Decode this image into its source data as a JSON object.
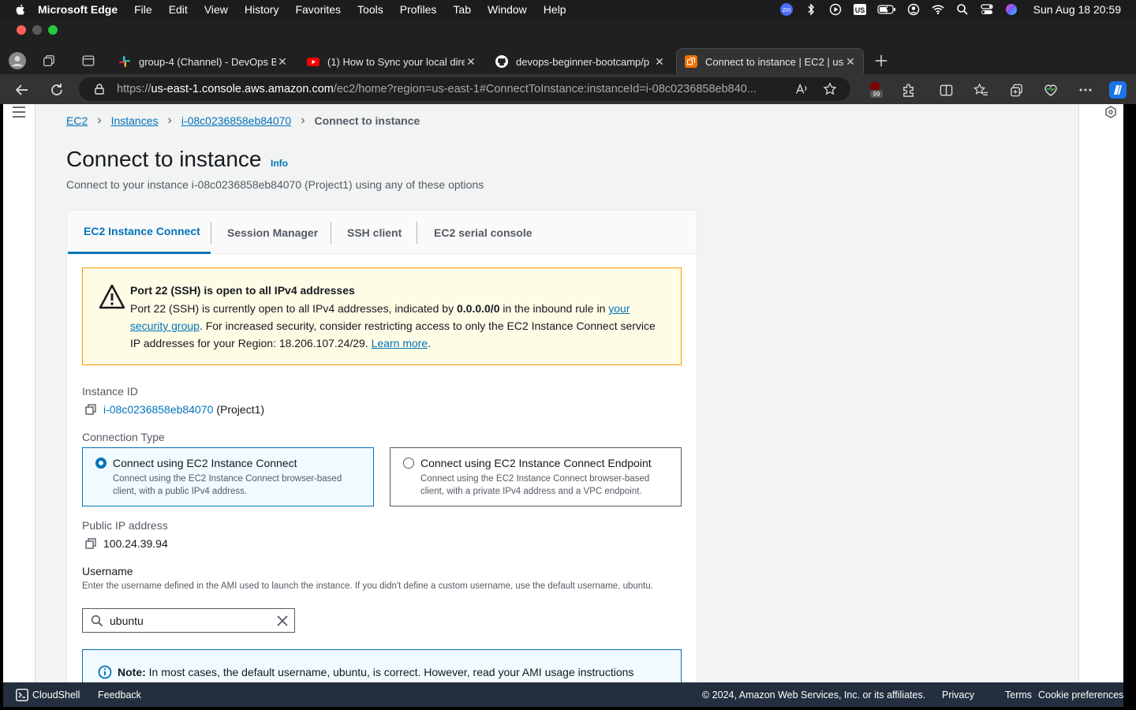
{
  "menubar": {
    "app": "Microsoft Edge",
    "items": [
      "File",
      "Edit",
      "View",
      "History",
      "Favorites",
      "Tools",
      "Profiles",
      "Tab",
      "Window",
      "Help"
    ],
    "clock": "Sun Aug 18  20:59",
    "status_icons": [
      "zoom-icon",
      "bluetooth-icon",
      "play-icon",
      "us-input-icon",
      "battery-icon",
      "user-icon",
      "wifi-icon",
      "spotlight-icon",
      "control-center-icon",
      "siri-icon"
    ],
    "us_label": "US",
    "zoom_label": "zm"
  },
  "tabs": [
    {
      "label": "group-4 (Channel) - DevOps B",
      "icon": "slack-icon"
    },
    {
      "label": "(1) How to Sync your local dire",
      "icon": "youtube-icon"
    },
    {
      "label": "devops-beginner-bootcamp/p",
      "icon": "github-icon"
    },
    {
      "label": "Connect to instance | EC2 | us-",
      "icon": "aws-icon",
      "active": true
    }
  ],
  "urlbar": {
    "scheme": "https://",
    "host": "us-east-1.console.aws.amazon.com",
    "path": "/ec2/home?region=us-east-1#ConnectToInstance:instanceId=i-08c0236858eb840..."
  },
  "extension_badge": "99",
  "breadcrumb": {
    "items": [
      "EC2",
      "Instances",
      "i-08c0236858eb84070"
    ],
    "current": "Connect to instance"
  },
  "page": {
    "title": "Connect to instance",
    "info": "Info",
    "subtitle": "Connect to your instance i-08c0236858eb84070 (Project1) using any of these options"
  },
  "connect_tabs": [
    "EC2 Instance Connect",
    "Session Manager",
    "SSH client",
    "EC2 serial console"
  ],
  "warning": {
    "heading": "Port 22 (SSH) is open to all IPv4 addresses",
    "text1": "Port 22 (SSH) is currently open to all IPv4 addresses, indicated by ",
    "cidr": "0.0.0.0/0",
    "text2": " in the inbound rule in ",
    "link1": "your security group",
    "text3": ". For increased security, consider restricting access to only the EC2 Instance Connect service IP addresses for your Region: 18.206.107.24/29. ",
    "link2": "Learn more",
    "text4": "."
  },
  "instance": {
    "label": "Instance ID",
    "id": "i-08c0236858eb84070",
    "name": "(Project1)"
  },
  "connection_type": {
    "label": "Connection Type",
    "options": [
      {
        "title": "Connect using EC2 Instance Connect",
        "desc": "Connect using the EC2 Instance Connect browser-based client, with a public IPv4 address.",
        "selected": true
      },
      {
        "title": "Connect using EC2 Instance Connect Endpoint",
        "desc": "Connect using the EC2 Instance Connect browser-based client, with a private IPv4 address and a VPC endpoint.",
        "selected": false
      }
    ]
  },
  "public_ip": {
    "label": "Public IP address",
    "value": "100.24.39.94"
  },
  "username": {
    "label": "Username",
    "desc": "Enter the username defined in the AMI used to launch the instance. If you didn't define a custom username, use the default username, ubuntu.",
    "value": "ubuntu"
  },
  "note": {
    "bold": "Note:",
    "text": " In most cases, the default username, ubuntu, is correct. However, read your AMI usage instructions"
  },
  "footer": {
    "cloudshell": "CloudShell",
    "feedback": "Feedback",
    "copyright": "© 2024, Amazon Web Services, Inc. or its affiliates.",
    "privacy": "Privacy",
    "terms": "Terms",
    "cookies": "Cookie preferences"
  },
  "colors": {
    "aws_link": "#0073bb",
    "warning_bg": "#fffce6",
    "warning_border": "#ff9900",
    "footer_bg": "#232f3e"
  }
}
